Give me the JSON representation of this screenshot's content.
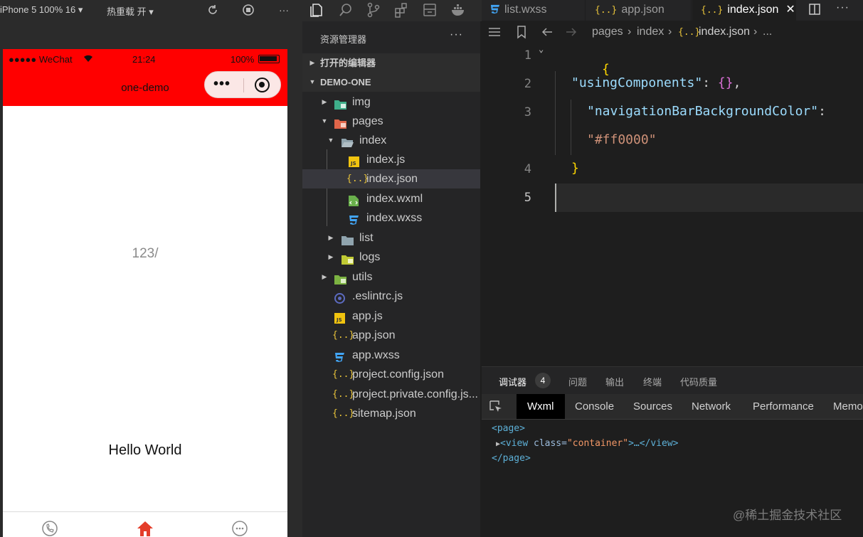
{
  "simulator": {
    "device": "iPhone 5 100% 16 ▾",
    "hot_reload": "热重载 开 ▾",
    "status": {
      "carrier": "●●●●● WeChat",
      "time": "21:24",
      "battery": "100%"
    },
    "nav_title": "one-demo",
    "nav_color": "#ff0000",
    "content_text": "123/",
    "hello_text": "Hello World"
  },
  "explorer": {
    "title": "资源管理器",
    "more": "···",
    "open_editors": "打开的编辑器",
    "project": "DEMO-ONE",
    "items": [
      {
        "label": "img",
        "kind": "folder"
      },
      {
        "label": "pages",
        "kind": "folder"
      },
      {
        "label": "index",
        "kind": "folder"
      },
      {
        "label": "index.js",
        "kind": "js"
      },
      {
        "label": "index.json",
        "kind": "json"
      },
      {
        "label": "index.wxml",
        "kind": "wxml"
      },
      {
        "label": "index.wxss",
        "kind": "wxss"
      },
      {
        "label": "list",
        "kind": "folder"
      },
      {
        "label": "logs",
        "kind": "folder"
      },
      {
        "label": "utils",
        "kind": "folder"
      },
      {
        "label": ".eslintrc.js",
        "kind": "eslint"
      },
      {
        "label": "app.js",
        "kind": "js"
      },
      {
        "label": "app.json",
        "kind": "json"
      },
      {
        "label": "app.wxss",
        "kind": "wxss"
      },
      {
        "label": "project.config.json",
        "kind": "json"
      },
      {
        "label": "project.private.config.js...",
        "kind": "json"
      },
      {
        "label": "sitemap.json",
        "kind": "json"
      }
    ]
  },
  "editor": {
    "tabs": [
      {
        "label": "list.wxss"
      },
      {
        "label": "app.json"
      },
      {
        "label": "index.json",
        "close": "✕"
      }
    ],
    "breadcrumb": [
      "pages",
      "index",
      "index.json",
      "..."
    ],
    "line_numbers": [
      "1",
      "2",
      "3",
      "4",
      "5"
    ],
    "code": {
      "open_brace": "{",
      "key1": "\"usingComponents\"",
      "colon": ": ",
      "empty_obj": "{}",
      "comma": ",",
      "key2": "\"navigationBarBackgroundColor\"",
      "colon2": ":",
      "val2": "\"#ff0000\"",
      "close_brace": "}"
    }
  },
  "panel": {
    "tabs": [
      "调试器",
      "问题",
      "输出",
      "终端",
      "代码质量"
    ],
    "badge": "4",
    "devtools_tabs": [
      "Wxml",
      "Console",
      "Sources",
      "Network",
      "Performance",
      "Memo"
    ],
    "wxml": {
      "line1": "<page>",
      "line2_tag": "<view",
      "line2_attr": " class=",
      "line2_val": "\"container\"",
      "line2_rest": ">…</view>",
      "line3": "</page>"
    }
  },
  "watermark": "@稀土掘金技术社区"
}
